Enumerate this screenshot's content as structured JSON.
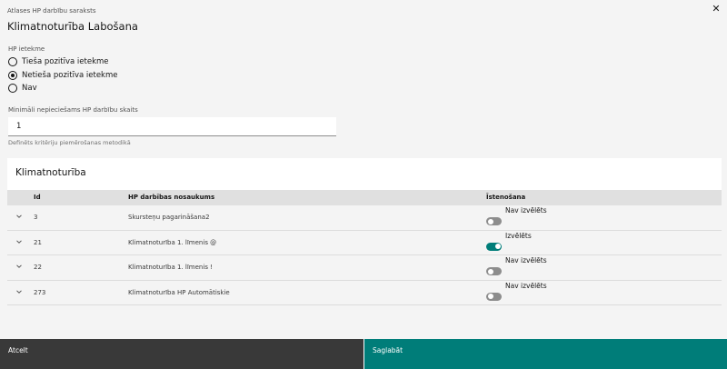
{
  "header": {
    "subtitle": "Atlases HP darbību saraksts",
    "title": "Klimatnoturība Labošana",
    "close_icon": "close-icon"
  },
  "impact": {
    "label": "HP ietekme",
    "options": [
      {
        "label": "Tieša pozitīva ietekme",
        "selected": false
      },
      {
        "label": "Netieša pozitīva ietekme",
        "selected": true
      },
      {
        "label": "Nav",
        "selected": false
      }
    ]
  },
  "min_count": {
    "label": "Minimāli nepieciešams HP darbību skaits",
    "value": "1",
    "helper": "Definēts kritēriju piemērošanas metodikā"
  },
  "table": {
    "title": "Klimatnoturība",
    "columns": {
      "id": "Id",
      "name": "HP darbības nosaukums",
      "status": "Īstenošana"
    },
    "rows": [
      {
        "id": "3",
        "name": "Skursteņu pagarināšana2",
        "status_label": "Nav izvēlēts",
        "on": false
      },
      {
        "id": "21",
        "name": "Klimatnoturība 1. līmenis @",
        "status_label": "Izvēlēts",
        "on": true
      },
      {
        "id": "22",
        "name": "Klimatnoturība 1. līmenis !",
        "status_label": "Nav izvēlēts",
        "on": false
      },
      {
        "id": "273",
        "name": "Klimatnoturība HP Automātiskie",
        "status_label": "Nav izvēlēts",
        "on": false
      }
    ]
  },
  "footer": {
    "cancel_label": "Atcelt",
    "save_label": "Saglabāt"
  },
  "colors": {
    "accent": "#007d79",
    "cancel_bg": "#393939"
  }
}
